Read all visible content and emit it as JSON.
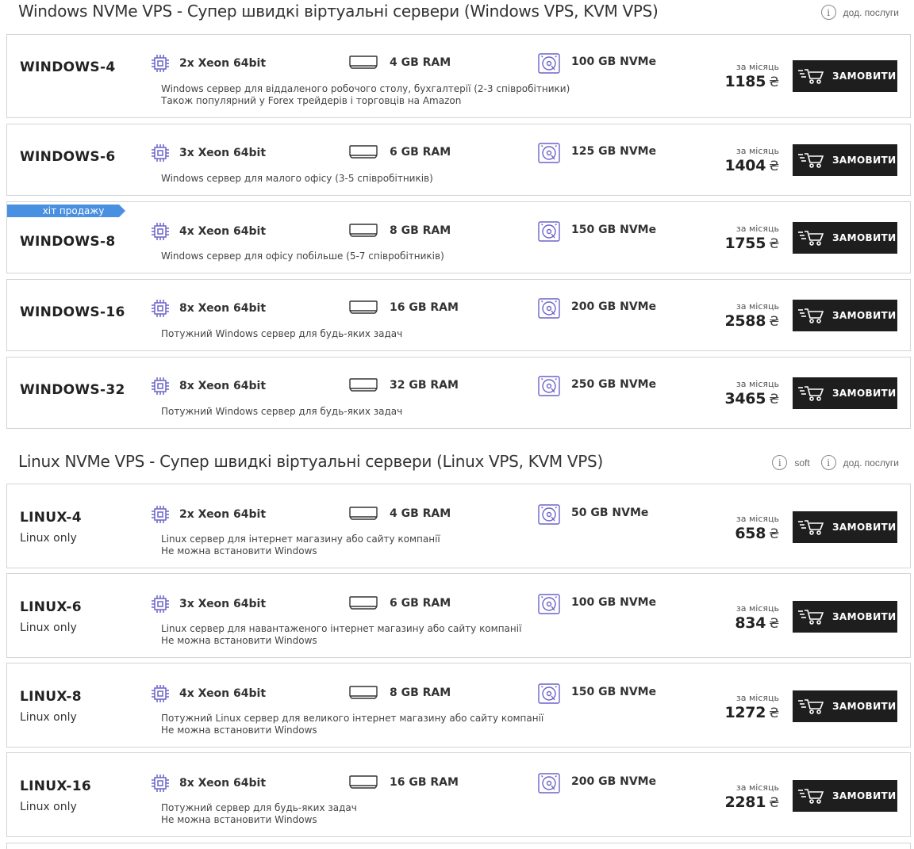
{
  "windows_section": {
    "title": "Windows NVMe VPS - Супер швидкі віртуальні сервери (Windows VPS, KVM VPS)",
    "links": [
      "дод. послуги"
    ]
  },
  "linux_section": {
    "title": "Linux NVMe VPS - Супер швидкі віртуальні сервери (Linux VPS, KVM VPS)",
    "links": [
      "soft",
      "дод. послуги"
    ]
  },
  "per_month_label": "за місяць",
  "currency": "₴",
  "order_label": "ЗАМОВИТИ",
  "hit_label": "хіт продажу",
  "windows_plans": [
    {
      "name": "WINDOWS-4",
      "cpu": "2x Xeon 64bit",
      "ram": "4 GB RAM",
      "disk": "100 GB NVMe",
      "desc1": "Windows сервер для віддаленого робочого столу, бухгалтерії (2-3 співробітники)",
      "desc2": "Також популярний у Forex трейдерів і торговців на Amazon",
      "price": "1185"
    },
    {
      "name": "WINDOWS-6",
      "cpu": "3x Xeon 64bit",
      "ram": "6 GB RAM",
      "disk": "125 GB NVMe",
      "desc1": "Windows сервер для малого офісу (3-5 співробітників)",
      "desc2": "",
      "price": "1404"
    },
    {
      "name": "WINDOWS-8",
      "cpu": "4x Xeon 64bit",
      "ram": "8 GB RAM",
      "disk": "150 GB NVMe",
      "desc1": "Windows сервер для офісу побільше (5-7 співробітників)",
      "desc2": "",
      "price": "1755"
    },
    {
      "name": "WINDOWS-16",
      "cpu": "8x Xeon 64bit",
      "ram": "16 GB RAM",
      "disk": "200 GB NVMe",
      "desc1": "Потужний Windows сервер для будь-яких задач",
      "desc2": "",
      "price": "2588"
    },
    {
      "name": "WINDOWS-32",
      "cpu": "8x Xeon 64bit",
      "ram": "32 GB RAM",
      "disk": "250 GB NVMe",
      "desc1": "Потужний Windows сервер для будь-яких задач",
      "desc2": "",
      "price": "3465"
    }
  ],
  "linux_plans": [
    {
      "name": "LINUX-4",
      "sub": "Linux only",
      "cpu": "2x Xeon 64bit",
      "ram": "4 GB RAM",
      "disk": "50 GB NVMe",
      "desc1": "Linux сервер для інтернет магазину або сайту компанії",
      "desc2": "Не можна встановити Windows",
      "price": "658"
    },
    {
      "name": "LINUX-6",
      "sub": "Linux only",
      "cpu": "3x Xeon 64bit",
      "ram": "6 GB RAM",
      "disk": "100 GB NVMe",
      "desc1": "Linux сервер для навантаженого інтернет магазину або сайту компанії",
      "desc2": "Не можна встановити Windows",
      "price": "834"
    },
    {
      "name": "LINUX-8",
      "sub": "Linux only",
      "cpu": "4x Xeon 64bit",
      "ram": "8 GB RAM",
      "disk": "150 GB NVMe",
      "desc1": "Потужний Linux сервер для великого інтернет магазину або сайту компанії",
      "desc2": "Не можна встановити Windows",
      "price": "1272"
    },
    {
      "name": "LINUX-16",
      "sub": "Linux only",
      "cpu": "8x Xeon 64bit",
      "ram": "16 GB RAM",
      "disk": "200 GB NVMe",
      "desc1": "Потужний сервер для будь-яких задач",
      "desc2": "Не можна встановити Windows",
      "price": "2281"
    }
  ],
  "colors": {
    "accent": "#4a90e2",
    "icon": "#6b64c9",
    "button": "#1e1e1e"
  }
}
